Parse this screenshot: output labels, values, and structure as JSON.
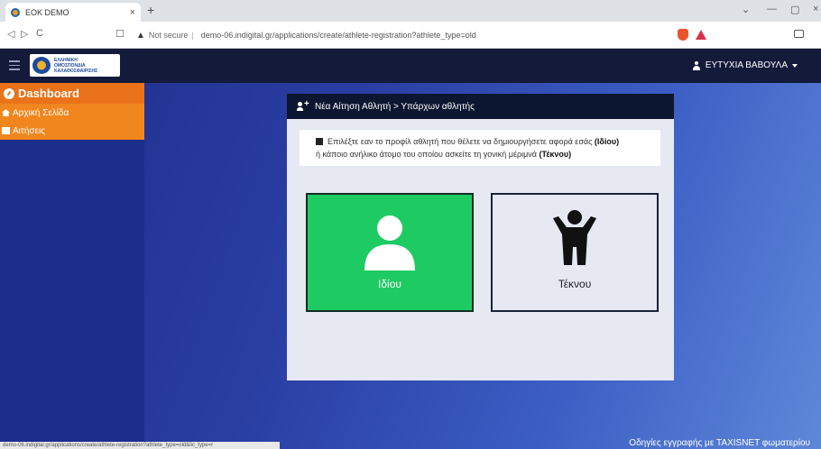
{
  "browser": {
    "tab_title": "EOK DEMO",
    "tab_close": "×",
    "new_tab": "+",
    "security_label": "Not secure",
    "url": "demo-06.indigital.gr/applications/create/athlete-registration?athlete_type=old",
    "status_url": "demo-06.indigital.gr/applications/create/athlete-registration?athlete_type=old&lic_type=r"
  },
  "header": {
    "logo_text_1": "ΕΛΛΗΝΙΚΗ",
    "logo_text_2": "ΟΜΟΣΠΟΝΔΙΑ",
    "logo_text_3": "ΚΑΛΑΘΟΣΦΑΙΡΙΣΗΣ",
    "user_name": "ΕΥΤΥΧΙΑ ΒΑΒΟΥΛΑ"
  },
  "sidebar": {
    "title": "Dashboard",
    "items": [
      {
        "label": "Αρχική Σελίδα",
        "icon": "home-icon"
      },
      {
        "label": "Αιτήσεις",
        "icon": "inbox-icon"
      }
    ]
  },
  "card": {
    "title": "Νέα Αίτηση Αθλητή > Υπάρχων αθλητής",
    "info_line1_pre": "Επιλέξτε εαν το προφίλ αθλητή που θέλετε να δημιουργήσετε αφορά εσάς ",
    "info_line1_bold": "(Ιδίου)",
    "info_line2_pre": "ή κάποιο ανήλικο άτομο του οποίου ασκείτε τη γονική μέριμνά ",
    "info_line2_bold": "(Τέκνου)",
    "option_self": "Ιδίου",
    "option_child": "Τέκνου"
  },
  "footer": {
    "link": "Οδηγίες εγγραφής με TAXISNET φωματερίου"
  },
  "colors": {
    "accent_orange": "#f0861d",
    "self_green": "#1ecb63",
    "nav_dark": "#131a3a"
  }
}
